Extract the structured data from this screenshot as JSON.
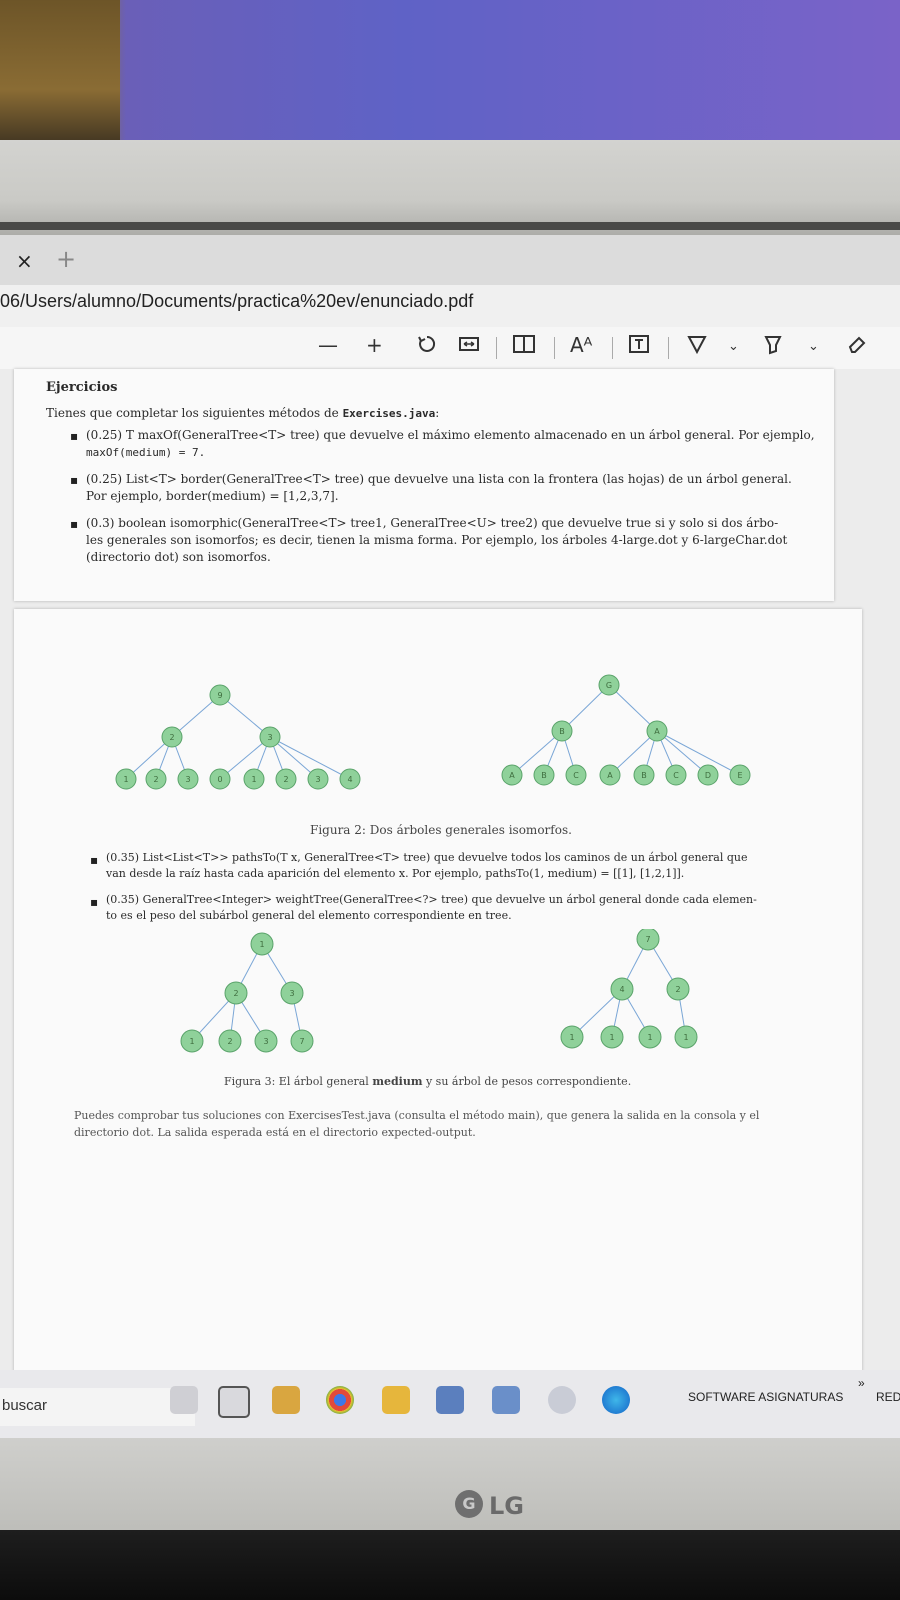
{
  "browser": {
    "tab_close": "×",
    "tab_new": "+",
    "url": "06/Users/alumno/Documents/practica%20ev/enunciado.pdf"
  },
  "pdf_toolbar": {
    "zoom_out": "—",
    "zoom_in": "+",
    "read_aloud": "Aᴬ"
  },
  "page1": {
    "heading": "Ejercicios",
    "intro": "Tienes que completar los siguientes métodos de ",
    "intro_code": "Exercises.java",
    "intro_end": ":",
    "items": [
      {
        "line1": "(0.25) T maxOf(GeneralTree<T> tree) que devuelve el máximo elemento almacenado en un árbol general. Por ejemplo,",
        "line2": "maxOf(medium) = 7."
      },
      {
        "line1": "(0.25) List<T> border(GeneralTree<T> tree) que devuelve una lista con la frontera (las hojas) de un árbol general.",
        "line2": "Por ejemplo, border(medium) = [1,2,3,7]."
      },
      {
        "line1": "(0.3) boolean isomorphic(GeneralTree<T> tree1, GeneralTree<U> tree2) que devuelve true si y solo si dos árbo-",
        "line2": "les generales son isomorfos; es decir, tienen la misma forma. Por ejemplo, los árboles 4-large.dot y 6-largeChar.dot",
        "line3": "(directorio dot) son isomorfos."
      }
    ]
  },
  "page2": {
    "fig2_caption": "Figura 2: Dos árboles generales isomorfos.",
    "items": [
      {
        "line1": "(0.35) List<List<T>> pathsTo(T x, GeneralTree<T> tree) que devuelve todos los caminos de un árbol general que",
        "line2": "van desde la raíz hasta cada aparición del elemento x. Por ejemplo, pathsTo(1, medium) = [[1], [1,2,1]]."
      },
      {
        "line1": "(0.35) GeneralTree<Integer> weightTree(GeneralTree<?> tree) que devuelve un árbol general donde cada elemen-",
        "line2": "to es el peso del subárbol general del elemento correspondiente en tree."
      }
    ],
    "fig3_caption_pre": "Figura 3: El árbol general ",
    "fig3_caption_bold": "medium",
    "fig3_caption_post": " y su árbol de pesos correspondiente.",
    "footer_line1": "Puedes comprobar tus soluciones con ExercisesTest.java (consulta el método main), que genera la salida en la consola y el",
    "footer_line2": "directorio dot. La salida esperada está en el directorio expected-output."
  },
  "trees": {
    "fig2_left": {
      "root": "9",
      "mid": [
        "2",
        "3"
      ],
      "leaves": [
        "1",
        "2",
        "3",
        "0",
        "1",
        "2",
        "3",
        "4"
      ]
    },
    "fig2_right": {
      "root": "G",
      "mid": [
        "B",
        "A"
      ],
      "leaves": [
        "A",
        "B",
        "C",
        "A",
        "B",
        "C",
        "D",
        "E"
      ]
    },
    "fig3_left": {
      "root": "1",
      "mid": [
        "2",
        "3"
      ],
      "leaves": [
        "1",
        "2",
        "3",
        "7"
      ]
    },
    "fig3_right": {
      "root": "7",
      "mid": [
        "4",
        "2"
      ],
      "leaves": [
        "1",
        "1",
        "1",
        "1"
      ]
    },
    "node_fill": "#8fd19a",
    "node_stroke": "#5aa36a",
    "edge_color": "#7aa6d6"
  },
  "taskbar": {
    "search": "buscar",
    "tray_label": "SOFTWARE ASIGNATURAS",
    "tray_right": "RED",
    "chevron": "»"
  },
  "monitor": {
    "brand": "LG"
  }
}
